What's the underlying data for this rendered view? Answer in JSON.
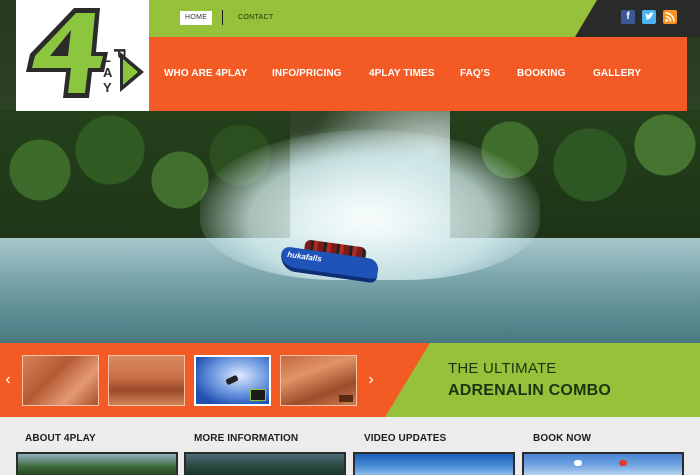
{
  "header": {
    "logo_alt": "4PLAY",
    "top_links": [
      {
        "label": "HOME"
      },
      {
        "label": "CONTACT"
      }
    ],
    "social": [
      {
        "name": "facebook-icon",
        "glyph": "f"
      },
      {
        "name": "twitter-icon",
        "glyph": "t"
      },
      {
        "name": "rss-icon",
        "glyph": ")"
      }
    ]
  },
  "nav": {
    "items": [
      {
        "label": "WHO ARE 4PLAY"
      },
      {
        "label": "INFO/PRICING"
      },
      {
        "label": "4PLAY TIMES"
      },
      {
        "label": "FAQ'S"
      },
      {
        "label": "BOOKING"
      },
      {
        "label": "GALLERY"
      }
    ]
  },
  "hero": {
    "boat_brand": "hukafalls"
  },
  "slider": {
    "prev": "‹",
    "next": "›",
    "tagline_line1": "THE ULTIMATE",
    "tagline_line2": "ADRENALIN COMBO"
  },
  "columns": [
    {
      "title": "ABOUT 4PLAY"
    },
    {
      "title": "MORE INFORMATION"
    },
    {
      "title": "VIDEO UPDATES"
    },
    {
      "title": "BOOK NOW"
    }
  ],
  "colors": {
    "brand_green": "#97c13a",
    "brand_orange": "#f45a24",
    "dark": "#2a2a2a"
  }
}
